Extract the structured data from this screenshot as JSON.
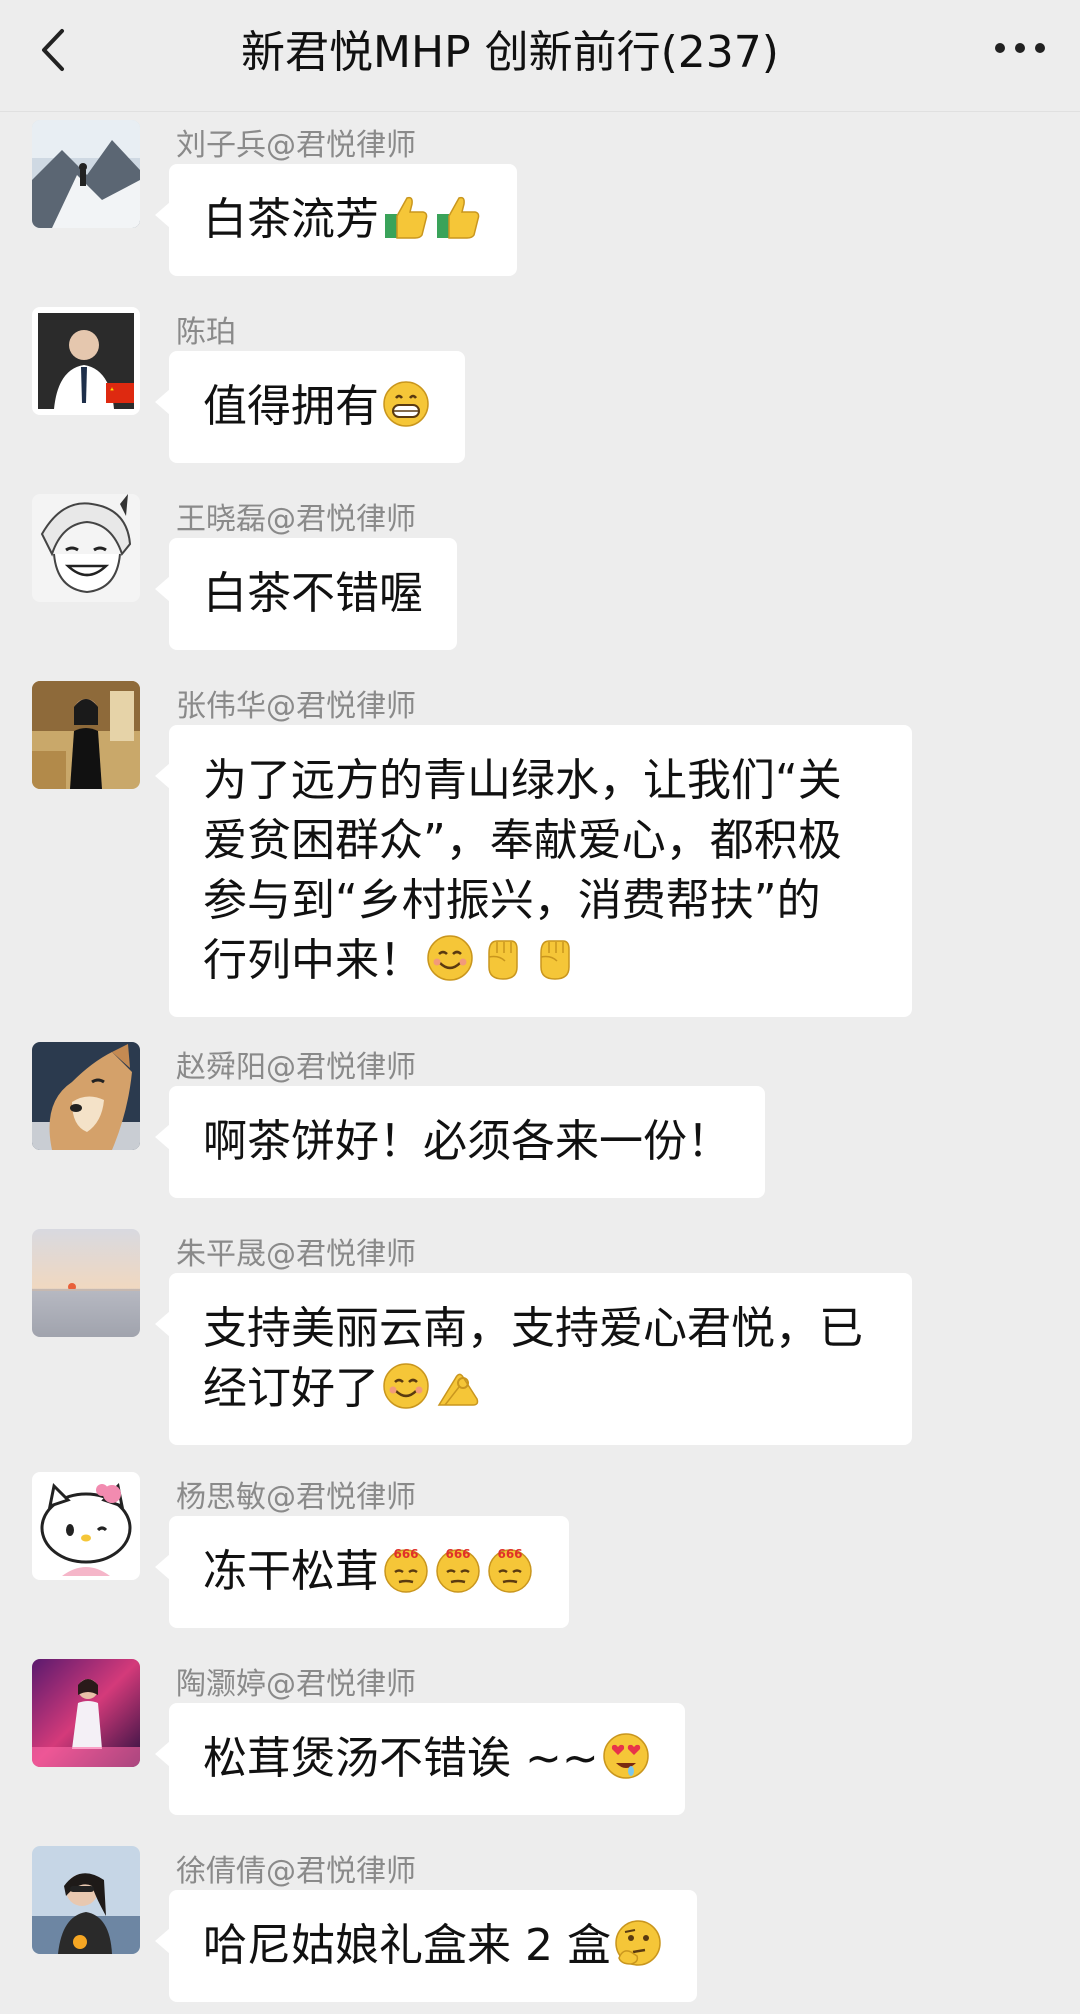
{
  "header": {
    "title": "新君悦MHP 创新前行(237)",
    "back_icon": "chevron-left-icon",
    "more_icon": "more-dots-icon"
  },
  "messages": [
    {
      "sender": "刘子兵@君悦律师",
      "text": "白茶流芳",
      "emojis": [
        "thumbs-up-icon",
        "thumbs-up-icon"
      ],
      "avatar": "mountain-climber-photo"
    },
    {
      "sender": "陈珀",
      "text": "值得拥有",
      "emojis": [
        "grin-icon"
      ],
      "avatar": "man-in-suit-photo"
    },
    {
      "sender": "王晓磊@君悦律师",
      "text": "白茶不错喔",
      "emojis": [],
      "avatar": "manga-character-drawing"
    },
    {
      "sender": "张伟华@君悦律师",
      "lines": [
        "为了远方的青山绿水，让我们“关",
        "爱贫困群众”，奉献爱心，都积极",
        "参与到“乡村振兴，消费帮扶”的",
        "行列中来！"
      ],
      "emojis": [
        "smile-icon",
        "fist-icon",
        "fist-icon"
      ],
      "avatar": "woman-in-room-photo"
    },
    {
      "sender": "赵舜阳@君悦律师",
      "text": "啊茶饼好！必须各来一份！",
      "emojis": [],
      "avatar": "shiba-dog-photo"
    },
    {
      "sender": "朱平晟@君悦律师",
      "lines": [
        "支持美丽云南，支持爱心君悦，已",
        "经订好了"
      ],
      "emojis": [
        "smile-icon",
        "ok-hand-icon"
      ],
      "avatar": "sunset-sea-photo"
    },
    {
      "sender": "杨思敏@君悦律师",
      "text": "冻干松茸",
      "emojis": [
        "666-icon",
        "666-icon",
        "666-icon"
      ],
      "avatar": "hello-kitty-image"
    },
    {
      "sender": "陶灏婷@君悦律师",
      "text": "松茸煲汤不错诶 ~~",
      "emojis": [
        "heart-eyes-drool-icon"
      ],
      "avatar": "girl-neon-photo"
    },
    {
      "sender": "徐倩倩@君悦律师",
      "text": "哈尼姑娘礼盒来 2 盒",
      "emojis": [
        "thinking-icon"
      ],
      "avatar": "woman-seaside-photo"
    }
  ],
  "colors": {
    "background": "#ededed",
    "bubble": "#ffffff",
    "sender_text": "#8a8a8a",
    "message_text": "#111111",
    "emoji_yellow": "#f5c638"
  }
}
